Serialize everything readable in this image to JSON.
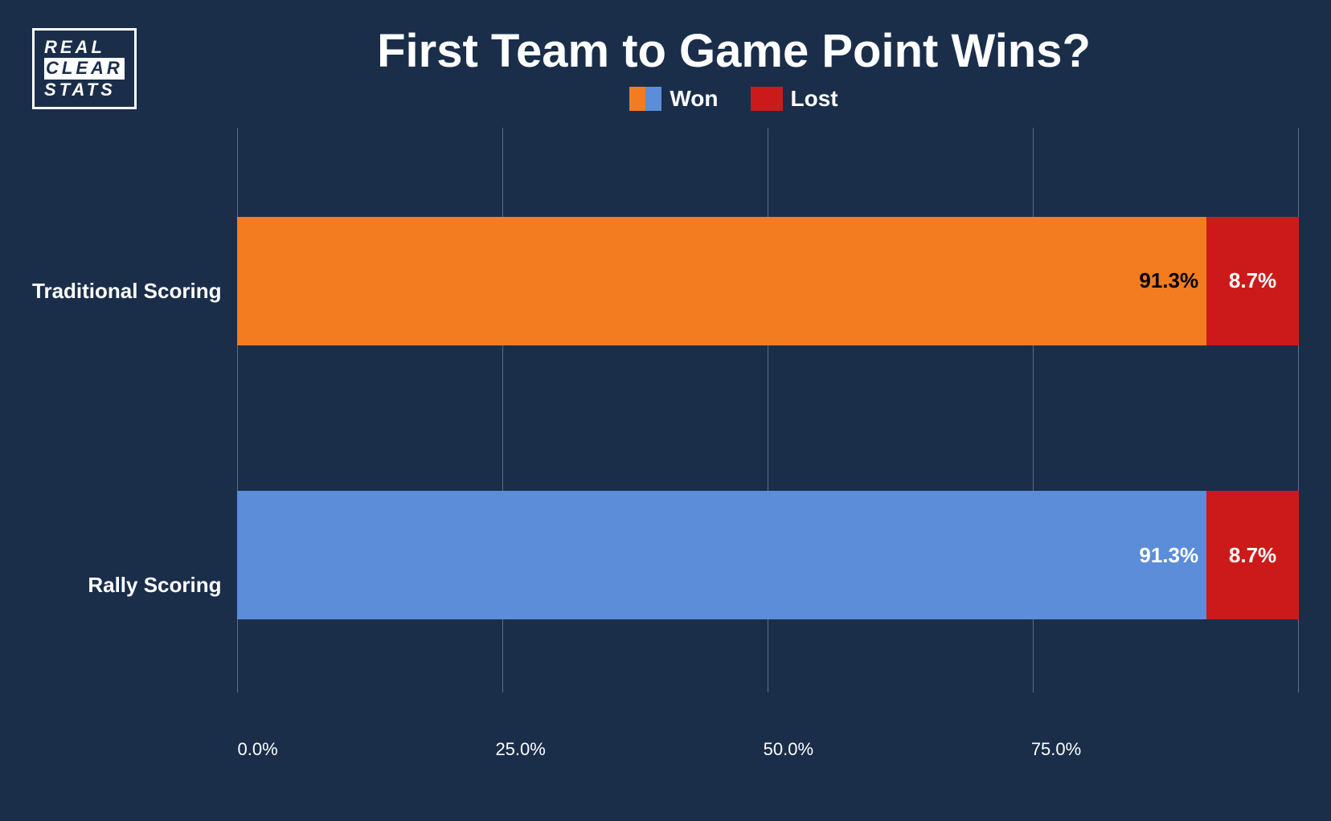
{
  "logo": {
    "lines": [
      "REAL",
      "CLEAR",
      "STATS"
    ]
  },
  "chart": {
    "title": "First Team to Game Point Wins?",
    "legend": {
      "won_label": "Won",
      "lost_label": "Lost"
    },
    "bars": [
      {
        "label": "Traditional Scoring",
        "won_pct": 91.3,
        "lost_pct": 8.7,
        "won_pct_label": "91.3%",
        "lost_pct_label": "8.7%",
        "color": "orange"
      },
      {
        "label": "Rally Scoring",
        "won_pct": 91.3,
        "lost_pct": 8.7,
        "won_pct_label": "91.3%",
        "lost_pct_label": "8.7%",
        "color": "blue"
      }
    ],
    "x_axis": {
      "labels": [
        "0.0%",
        "25.0%",
        "50.0%",
        "75.0%",
        ""
      ]
    }
  }
}
